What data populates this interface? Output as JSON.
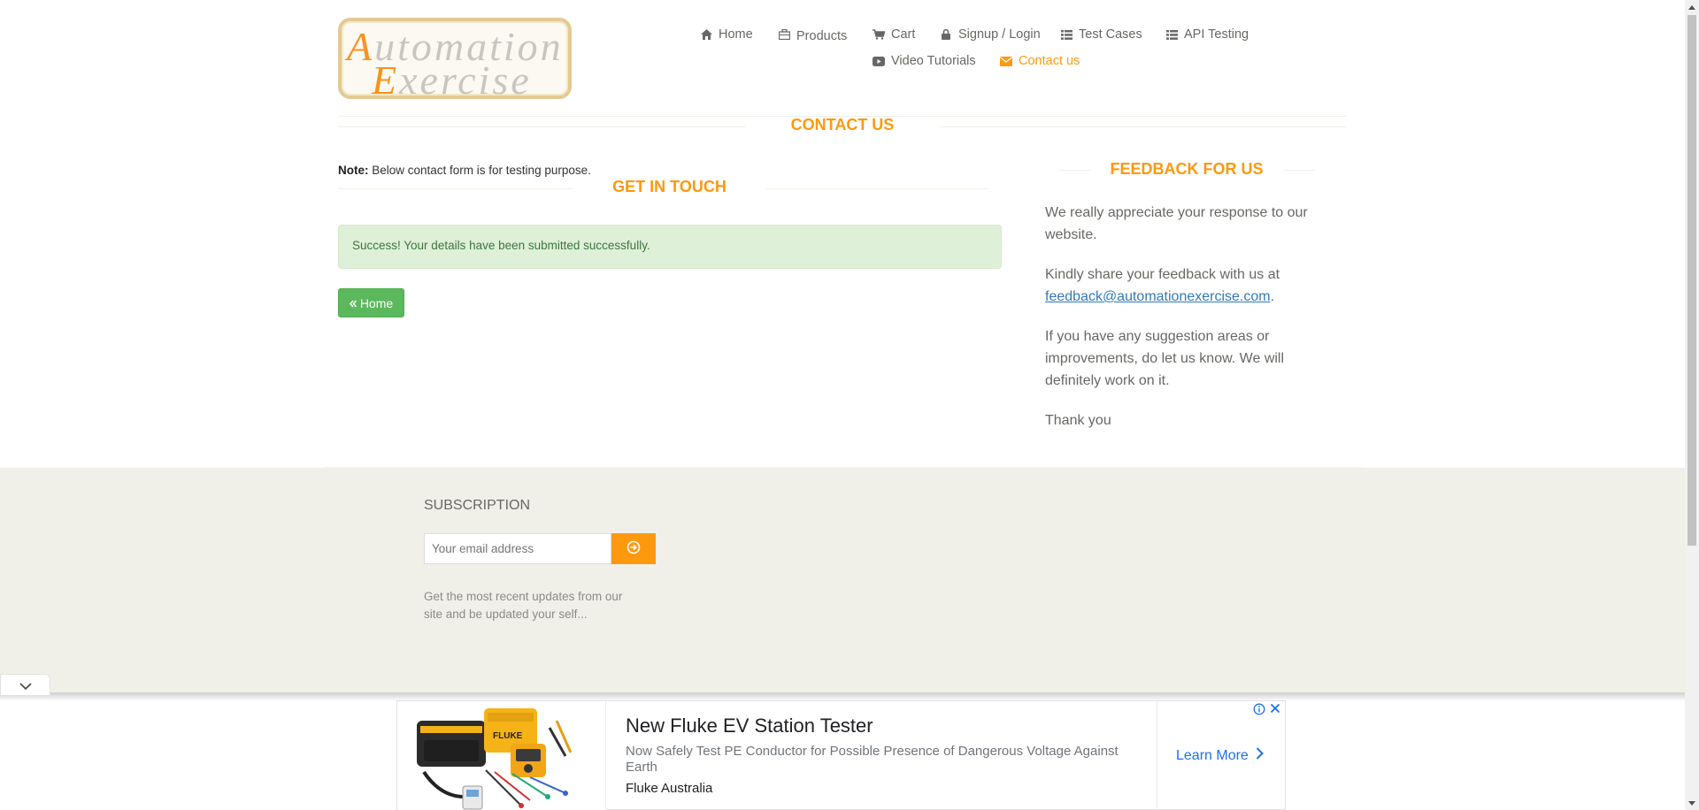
{
  "header": {
    "logo": {
      "line1_cap": "A",
      "line1_rest": "utomation",
      "line2_cap": "E",
      "line2_rest": "xercise"
    },
    "nav": [
      {
        "label": "Home",
        "icon": "home-icon"
      },
      {
        "label": "Products",
        "icon": "products-icon"
      },
      {
        "label": "Cart",
        "icon": "cart-icon"
      },
      {
        "label": "Signup / Login",
        "icon": "lock-icon"
      },
      {
        "label": "Test Cases",
        "icon": "list-icon"
      },
      {
        "label": "API Testing",
        "icon": "list-icon"
      },
      {
        "label": "Video Tutorials",
        "icon": "youtube-icon"
      },
      {
        "label": "Contact us",
        "icon": "envelope-icon",
        "active": true
      }
    ]
  },
  "contact": {
    "title": "CONTACT US",
    "note_label": "Note:",
    "note_text": " Below contact form is for testing purpose.",
    "get_in_touch": "GET IN TOUCH",
    "success_message": "Success! Your details have been submitted successfully.",
    "home_button": "Home"
  },
  "feedback": {
    "title": "FEEDBACK FOR US",
    "p1": "We really appreciate your response to our website.",
    "p2_prefix": "Kindly share your feedback with us at ",
    "email": "feedback@automationexercise.com",
    "p2_suffix": ".",
    "p3": "If you have any suggestion areas or improvements, do let us know. We will definitely work on it.",
    "p4": "Thank you"
  },
  "footer": {
    "subscription_title": "SUBSCRIPTION",
    "email_placeholder": "Your email address",
    "description": "Get the most recent updates from our site and be updated your self..."
  },
  "ad": {
    "title": "New Fluke EV Station Tester",
    "description": "Now Safely Test PE Conductor for Possible Presence of Dangerous Voltage Against Earth",
    "brand": "Fluke Australia",
    "cta": "Learn More"
  },
  "colors": {
    "accent": "#fe980f",
    "success_bg": "#dff0d8",
    "success_text": "#3c763d",
    "button_green": "#5cb85c",
    "footer_bg": "#f0f0e9",
    "link": "#337ab7"
  }
}
